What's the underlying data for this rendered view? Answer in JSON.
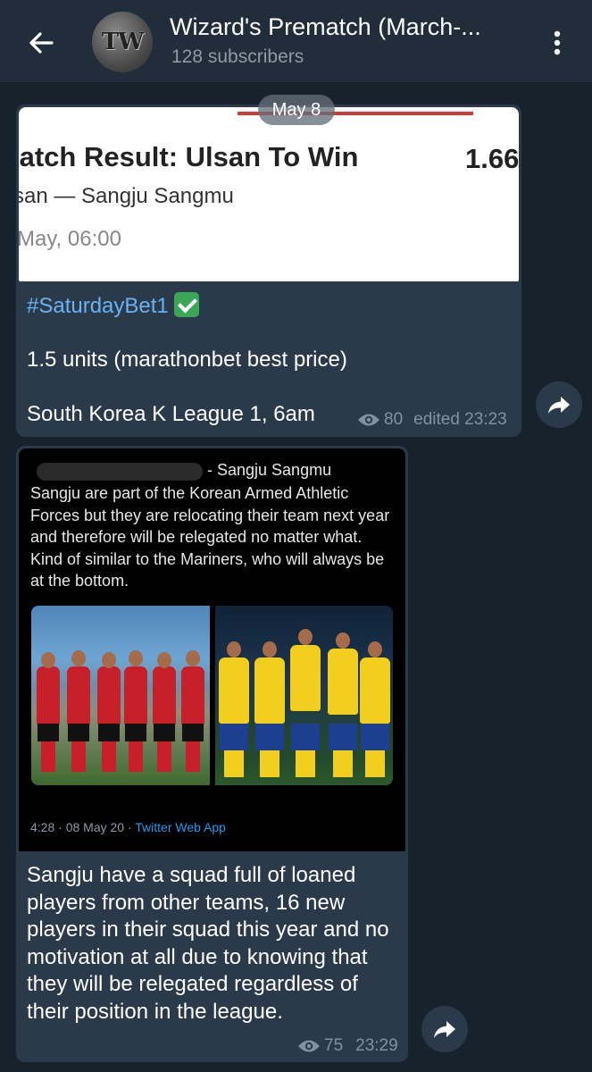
{
  "header": {
    "avatar_text": "TW",
    "title": "Wizard's Prematch (March-...",
    "subtitle": "128 subscribers"
  },
  "date_pill": "May 8",
  "post1": {
    "preview": {
      "line1": "latch Result: Ulsan To Win",
      "odds": "1.66",
      "line2": "san — Sangju Sangmu",
      "line3": "May, 06:00"
    },
    "hashtag": "#SaturdayBet1",
    "line2": "1.5 units (marathonbet best price)",
    "line3": "South Korea K League 1, 6am",
    "views": "80",
    "time": "edited 23:23"
  },
  "post2": {
    "tweet": {
      "header": "- Sangju Sangmu",
      "body": "Sangju are part of the Korean Armed Athletic Forces but they are relocating their team next year and therefore will be relegated no matter what. Kind of similar to the Mariners, who will always be at the bottom.",
      "footer_time": "4:28 · 08 May 20 · ",
      "footer_source": "Twitter Web App"
    },
    "text": "Sangju have a squad full of loaned players from other teams, 16 new players in their squad this year and no motivation at all due to knowing that they will be relegated regardless of their position in the league.",
    "views": "75",
    "time": "23:29"
  },
  "icons": {
    "back": "arrow-left-icon",
    "menu": "more-vertical-icon",
    "forward": "share-forward-icon",
    "views": "eye-icon",
    "check": "check-box-icon"
  },
  "colors": {
    "header_bg": "#212d3b",
    "chat_bg": "#18222d",
    "bubble_bg": "#2b3a4a",
    "link": "#6ab2f2",
    "meta": "#8093a5"
  }
}
